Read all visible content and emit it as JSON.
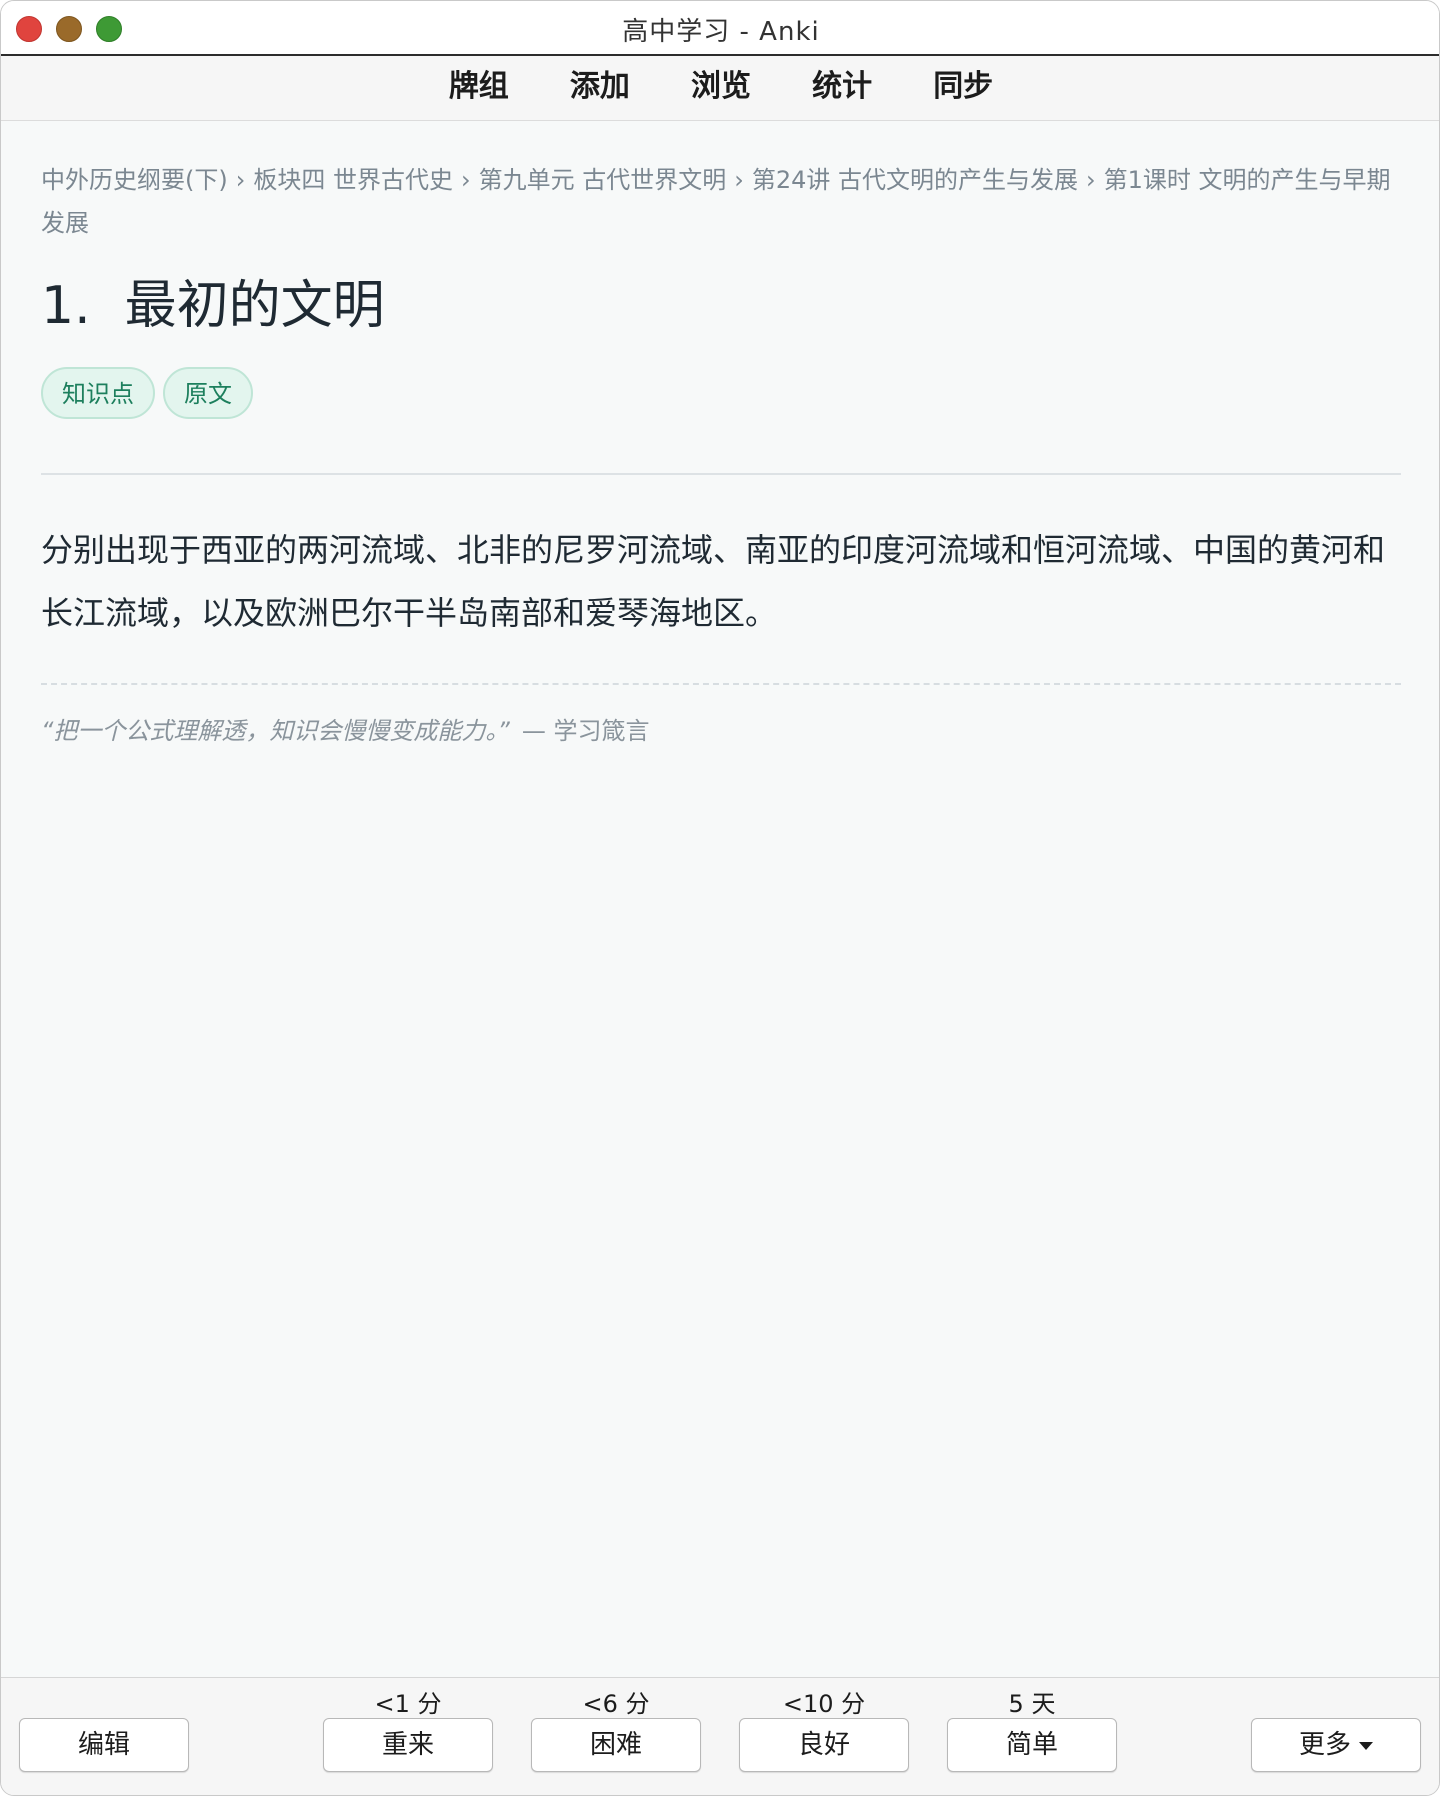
{
  "window": {
    "title": "高中学习 - Anki"
  },
  "topnav": {
    "items": [
      {
        "label": "牌组"
      },
      {
        "label": "添加"
      },
      {
        "label": "浏览"
      },
      {
        "label": "统计"
      },
      {
        "label": "同步"
      }
    ]
  },
  "card": {
    "breadcrumb": [
      "中外历史纲要(下)",
      "板块四 世界古代史",
      "第九单元 古代世界文明",
      "第24讲 古代文明的产生与发展",
      "第1课时 文明的产生与早期发展"
    ],
    "breadcrumb_separator": "›",
    "title_number": "1.",
    "title": "最初的文明",
    "tags": [
      "知识点",
      "原文"
    ],
    "answer": "分别出现于西亚的两河流域、北非的尼罗河流域、南亚的印度河流域和恒河流域、中国的黄河和长江流域，以及欧洲巴尔干半岛南部和爱琴海地区。",
    "quote": "“把一个公式理解透，知识会慢慢变成能力。”",
    "quote_source": "— 学习箴言"
  },
  "bottombar": {
    "edit_label": "编辑",
    "more_label": "更多",
    "answers": [
      {
        "label": "重来",
        "interval": "<1 分"
      },
      {
        "label": "困难",
        "interval": "<6 分"
      },
      {
        "label": "良好",
        "interval": "<10 分"
      },
      {
        "label": "简单",
        "interval": "5 天"
      }
    ]
  },
  "colors": {
    "tag_text": "#1d7f5d",
    "tag_background": "#e3f5ee",
    "breadcrumb_text": "#7b8791",
    "close_light": "#e0443e",
    "minimize_light": "#9a6a2a",
    "maximize_light": "#3e9a35"
  }
}
